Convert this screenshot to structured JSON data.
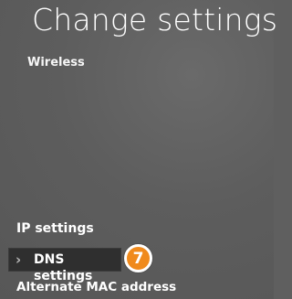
{
  "header": {
    "title": "Change settings",
    "network_name": "Wireless"
  },
  "menu": {
    "ip_settings": "IP settings",
    "dns_settings": "DNS settings",
    "alternate_mac": "Alternate MAC address"
  },
  "selected_item": "dns_settings",
  "step_badge": "7",
  "colors": {
    "background": "#5f5f5f",
    "selected_bg": "#2f2f2f",
    "badge": "#f08a1c",
    "text": "#ffffff"
  },
  "icons": {
    "selection_indicator": "chevron-right-icon"
  }
}
